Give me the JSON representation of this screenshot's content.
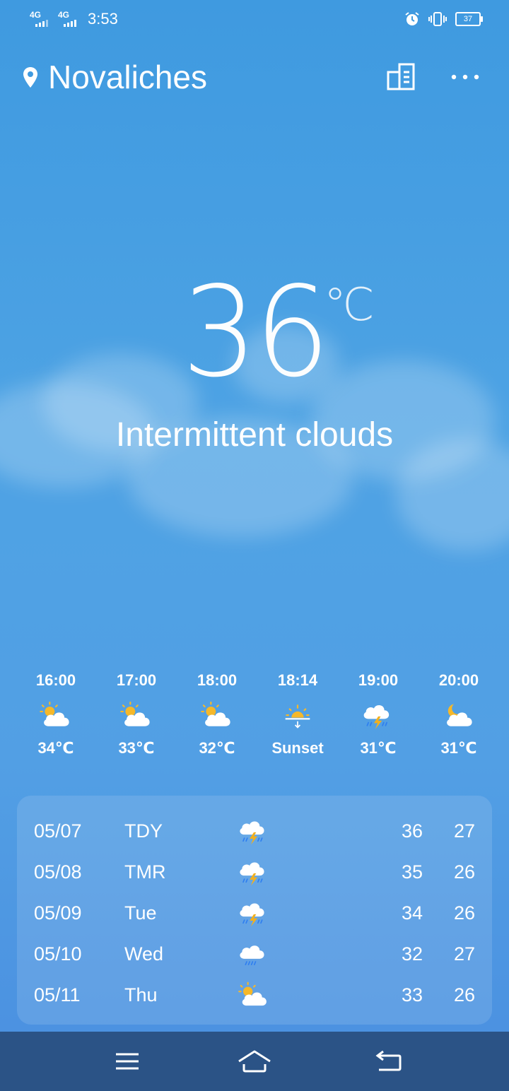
{
  "status_bar": {
    "net1": "4G",
    "net2": "4G",
    "time": "3:53",
    "battery": "37"
  },
  "header": {
    "city": "Novaliches"
  },
  "current": {
    "temp": "36",
    "unit": "℃",
    "condition": "Intermittent clouds"
  },
  "hourly": [
    {
      "time": "16:00",
      "value": "34℃",
      "icon": "partly-sunny-icon"
    },
    {
      "time": "17:00",
      "value": "33℃",
      "icon": "partly-sunny-icon"
    },
    {
      "time": "18:00",
      "value": "32℃",
      "icon": "partly-sunny-icon"
    },
    {
      "time": "18:14",
      "value": "Sunset",
      "icon": "sunset-icon"
    },
    {
      "time": "19:00",
      "value": "31℃",
      "icon": "thunderstorm-icon"
    },
    {
      "time": "20:00",
      "value": "31℃",
      "icon": "partly-cloudy-night-icon"
    }
  ],
  "daily": [
    {
      "date": "05/07",
      "day": "TDY",
      "icon": "thunderstorm-icon",
      "high": "36",
      "low": "27"
    },
    {
      "date": "05/08",
      "day": "TMR",
      "icon": "thunderstorm-icon",
      "high": "35",
      "low": "26"
    },
    {
      "date": "05/09",
      "day": "Tue",
      "icon": "thunderstorm-icon",
      "high": "34",
      "low": "26"
    },
    {
      "date": "05/10",
      "day": "Wed",
      "icon": "rain-icon",
      "high": "32",
      "low": "27"
    },
    {
      "date": "05/11",
      "day": "Thu",
      "icon": "partly-sunny-icon",
      "high": "33",
      "low": "26"
    }
  ],
  "colors": {
    "accent_sun": "#f5b82a",
    "bolt": "#f2b01e",
    "rain": "#2f7ff0",
    "nav_bar": "#2b5386"
  }
}
